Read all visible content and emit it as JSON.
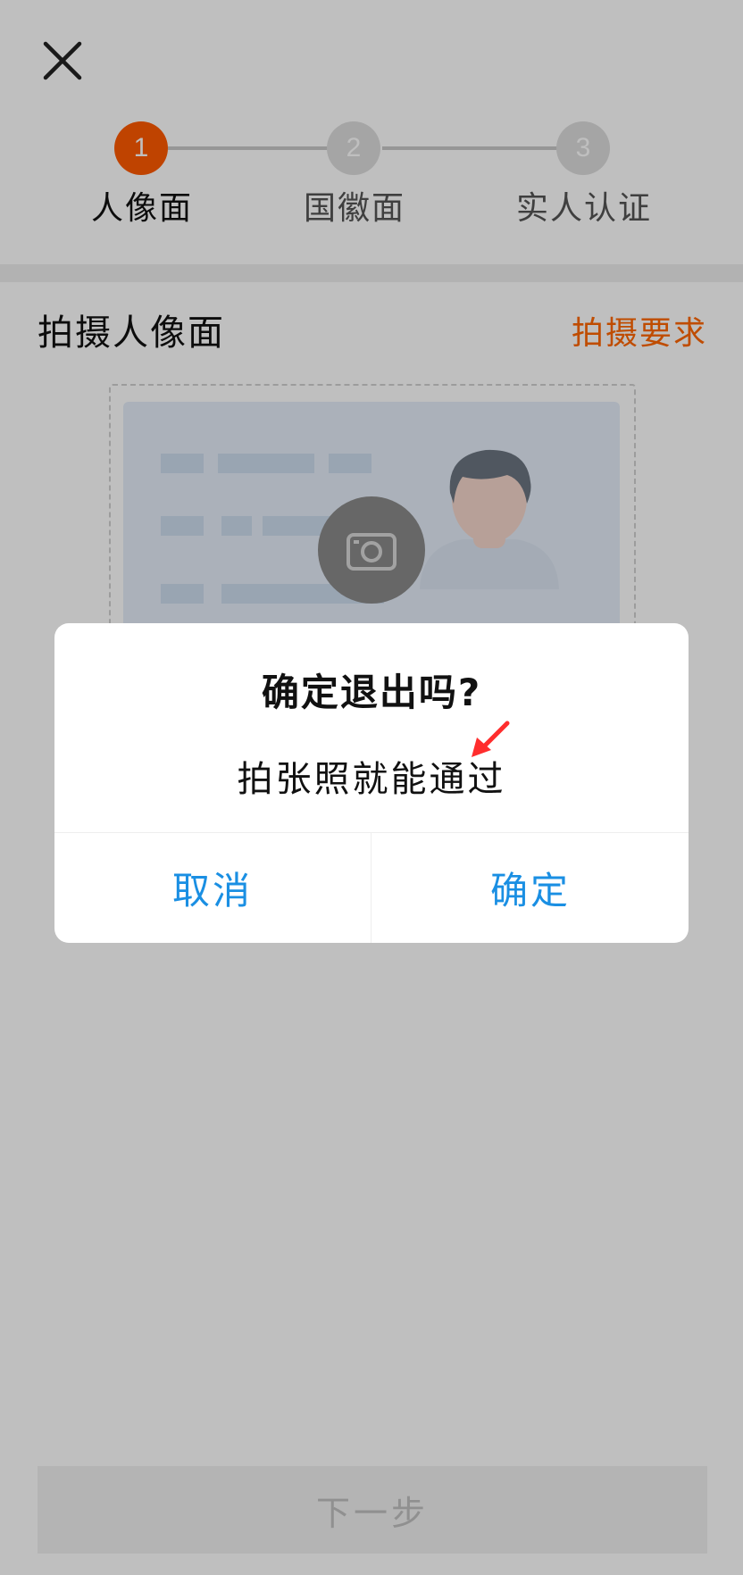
{
  "header": {
    "close_icon": "close-icon"
  },
  "stepper": {
    "steps": [
      {
        "number": "1",
        "label": "人像面",
        "active": true
      },
      {
        "number": "2",
        "label": "国徽面",
        "active": false
      },
      {
        "number": "3",
        "label": "实人认证",
        "active": false
      }
    ],
    "active_color": "#ff5a00",
    "inactive_color": "#dcdcdc"
  },
  "section": {
    "title": "拍摄人像面",
    "requirements_link": "拍摄要求"
  },
  "id_card": {
    "camera_icon": "camera-icon",
    "portrait_icon": "person-silhouette-icon"
  },
  "footer": {
    "next_label": "下一步"
  },
  "dialog": {
    "title": "确定退出吗?",
    "message": "拍张照就能通过",
    "cancel_label": "取消",
    "confirm_label": "确定",
    "button_color": "#1a8fe3"
  },
  "annotation": {
    "arrow_icon": "red-arrow-icon",
    "color": "#ff2d2d"
  }
}
